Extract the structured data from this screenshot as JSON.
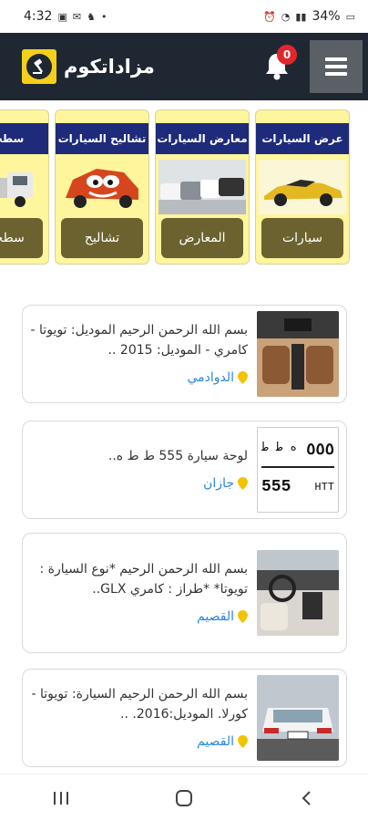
{
  "status": {
    "time": "4:32",
    "battery": "34%"
  },
  "header": {
    "title": "مزاداتكوم",
    "notifications": "0"
  },
  "categories": [
    {
      "title": "عرض السيارات",
      "button": "سيارات"
    },
    {
      "title": "معارض السيارات",
      "button": "المعارض"
    },
    {
      "title": "تشاليح السيارات",
      "button": "تشاليح"
    },
    {
      "title": "سطحات",
      "button": "سطحات"
    }
  ],
  "listings": [
    {
      "desc": "بسم الله الرحمن الرحيم الموديل: تويوتا - كامري - الموديل: 2015 ..",
      "location": "الدوادمي"
    },
    {
      "desc": "لوحة سيارة 555 ط ط ه..",
      "location": "جازان"
    },
    {
      "desc": "بسم الله الرحمن الرحيم *نوع السيارة : تويوتا* *طراز : كامري GLX..",
      "location": "القصيم"
    },
    {
      "desc": "بسم الله الرحمن الرحيم السيارة: تويوتا - كورلا. الموديل:2016. ..",
      "location": "القصيم"
    }
  ],
  "plate": {
    "top_ar": "ه ط ط",
    "top_num": "٥٥٥",
    "bottom_num": "555",
    "bottom_en": "HTT"
  }
}
